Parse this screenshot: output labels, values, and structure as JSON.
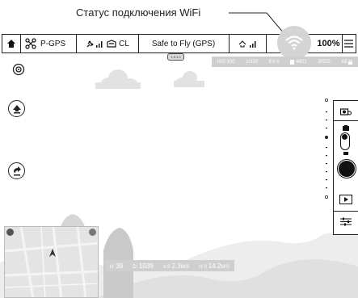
{
  "caption": "Статус подключения WiFi",
  "topbar": {
    "flight_mode": "P-GPS",
    "control_mode": "CL",
    "status": "Safe to Fly (GPS)",
    "battery": "100%"
  },
  "camera_params": {
    "iso": "ISO 100",
    "shutter": "1/320",
    "ev": "EV 0",
    "capacity": "4821",
    "format": "JPEG",
    "ae": "AE"
  },
  "gimbal_indicator": "1.5 1.0",
  "telemetry": {
    "h_label": "H:",
    "h_value": "39",
    "d_label": "D:",
    "d_value": "1039",
    "vs_label": "V.S",
    "vs_value": "2.3",
    "vs_unit": "M/S",
    "hs_label": "H.S",
    "hs_value": "14.2",
    "hs_unit": "M/S"
  },
  "colors": {
    "wifi_highlight": "#d4d4d4",
    "strip": "#cfcfcf",
    "line": "#222222"
  }
}
